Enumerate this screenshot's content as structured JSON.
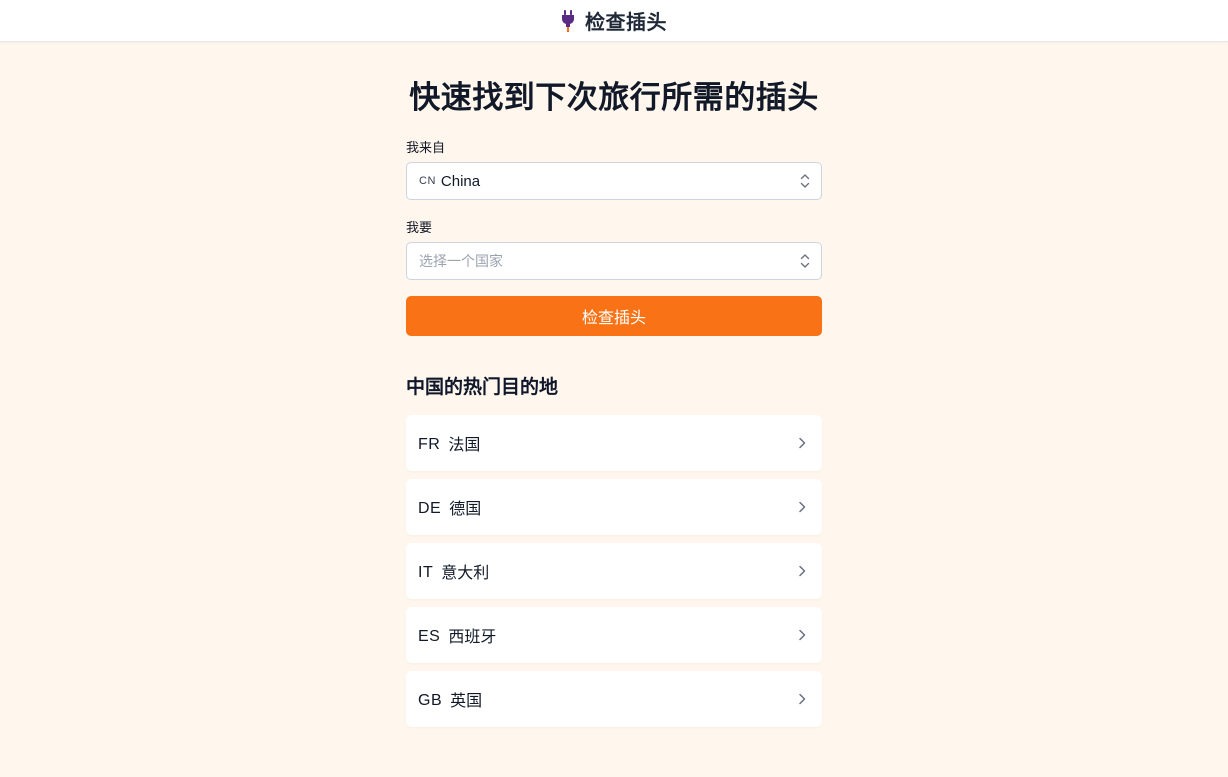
{
  "header": {
    "icon": "plug-icon",
    "title": "检查插头"
  },
  "main": {
    "headline": "快速找到下次旅行所需的插头",
    "from": {
      "label": "我来自",
      "code": "CN",
      "value": "China"
    },
    "to": {
      "label": "我要",
      "placeholder": "选择一个国家"
    },
    "check_button": "检查插头",
    "popular_title": "中国的热门目的地",
    "destinations": [
      {
        "code": "FR",
        "name": "法国"
      },
      {
        "code": "DE",
        "name": "德国"
      },
      {
        "code": "IT",
        "name": "意大利"
      },
      {
        "code": "ES",
        "name": "西班牙"
      },
      {
        "code": "GB",
        "name": "英国"
      }
    ]
  },
  "colors": {
    "background": "#fff6ed",
    "accent": "#f97316",
    "icon": "#5b2b83"
  }
}
